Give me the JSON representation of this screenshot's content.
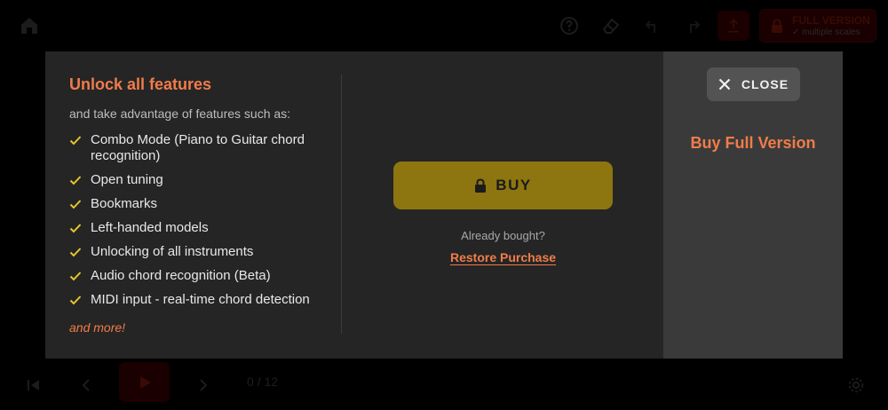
{
  "topbar": {
    "full_version_title": "FULL VERSION",
    "full_version_sub": "✓ multiple scales",
    "icons": [
      "home-icon",
      "help-icon",
      "eraser-icon",
      "undo-icon",
      "redo-icon",
      "upload-icon",
      "lock-icon"
    ]
  },
  "bottombar": {
    "counter": "0 / 12",
    "icons": [
      "skip-start-icon",
      "prev-icon",
      "play-icon",
      "next-icon",
      "settings-icon"
    ]
  },
  "modal": {
    "headline": "Unlock all features",
    "intro": "and take advantage of features such as:",
    "features": [
      "Combo Mode (Piano to Guitar chord recognition)",
      "Open tuning",
      "Bookmarks",
      "Left-handed models",
      "Unlocking of all instruments",
      "Audio chord recognition (Beta)",
      "MIDI input - real-time chord detection"
    ],
    "and_more": "and more!",
    "buy_label": "BUY",
    "already_bought": "Already bought?",
    "restore_label": "Restore Purchase",
    "close_label": "CLOSE",
    "buy_full_label": "Buy Full Version"
  },
  "colors": {
    "accent": "#f07c4a",
    "buy_button": "#8d7510",
    "check": "#e8c62c",
    "modal_bg": "#252525",
    "side_panel_bg": "#3a3a3a"
  }
}
